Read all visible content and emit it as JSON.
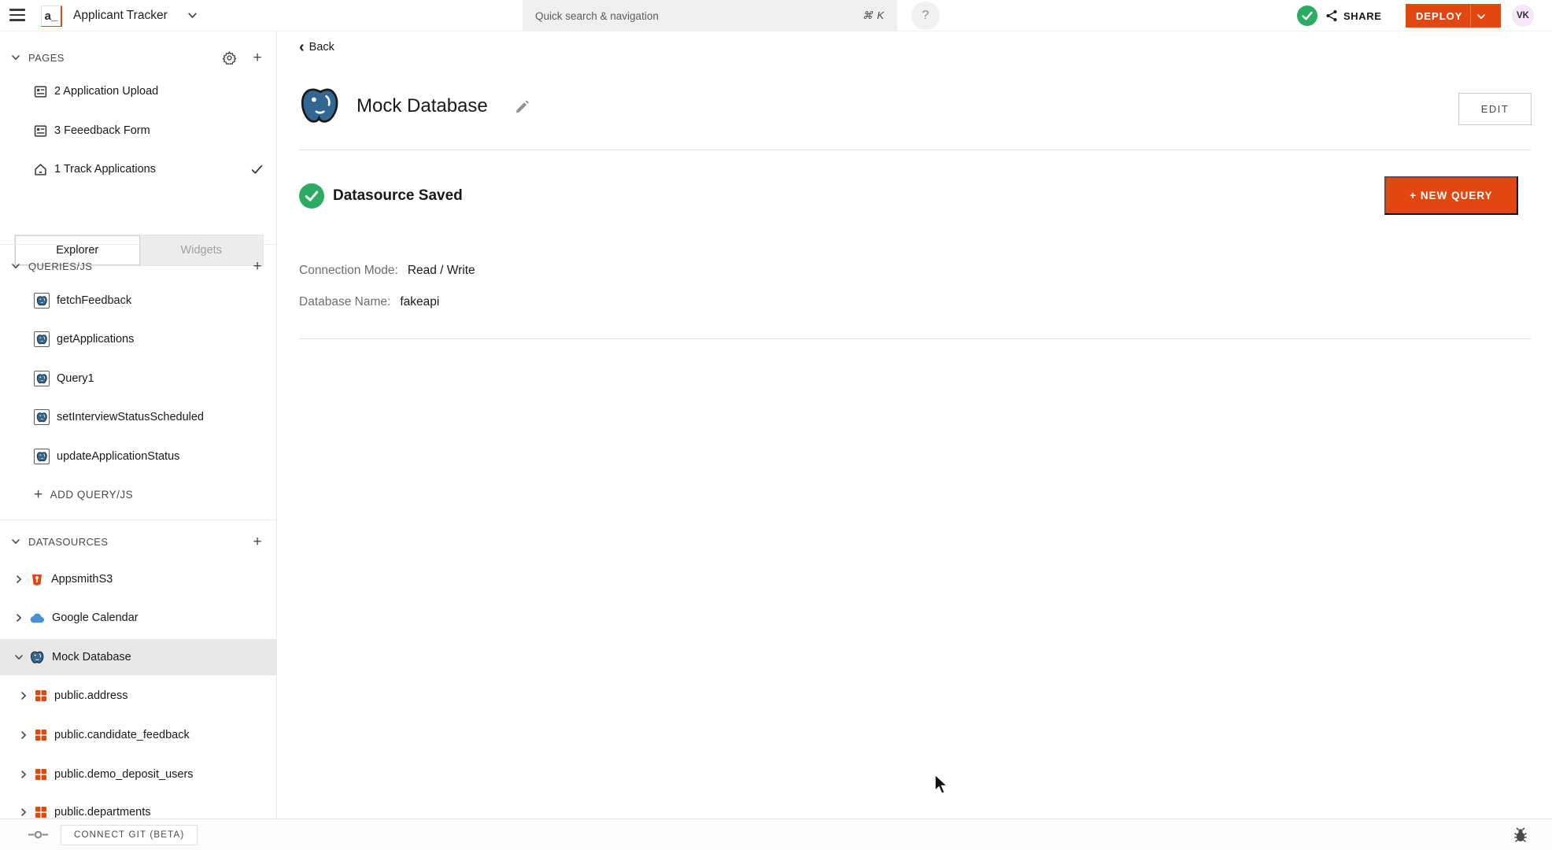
{
  "topbar": {
    "logo_text": "a_",
    "app_title": "Applicant Tracker",
    "search_placeholder": "Quick search & navigation",
    "search_shortcut": "⌘ K",
    "help_glyph": "?",
    "share_label": "SHARE",
    "deploy_label": "DEPLOY",
    "avatar_initials": "VK"
  },
  "icons": {
    "plus": "+",
    "back_chevron": "‹"
  },
  "sidebar": {
    "pages": {
      "title": "PAGES",
      "items": [
        {
          "label": "2 Application Upload"
        },
        {
          "label": "3 Feeedback Form"
        },
        {
          "label": "1 Track Applications"
        }
      ]
    },
    "tabs": {
      "explorer": "Explorer",
      "widgets": "Widgets"
    },
    "queries": {
      "title": "QUERIES/JS",
      "items": [
        "fetchFeedback",
        "getApplications",
        "Query1",
        "setInterviewStatusScheduled",
        "updateApplicationStatus"
      ],
      "add_label": "ADD QUERY/JS"
    },
    "datasources": {
      "title": "DATASOURCES",
      "items": [
        {
          "label": "AppsmithS3"
        },
        {
          "label": "Google Calendar"
        },
        {
          "label": "Mock Database"
        },
        {
          "label": "public.address"
        },
        {
          "label": "public.candidate_feedback"
        },
        {
          "label": "public.demo_deposit_users"
        },
        {
          "label": "public.departments"
        }
      ]
    }
  },
  "footer": {
    "connect_git_label": "CONNECT GIT (BETA)"
  },
  "main": {
    "back_label": "Back",
    "title": "Mock Database",
    "edit_button": "EDIT",
    "status_label": "Datasource Saved",
    "new_query_button": "+ NEW QUERY",
    "fields": [
      {
        "label": "Connection Mode:",
        "value": "Read / Write"
      },
      {
        "label": "Database Name:",
        "value": "fakeapi"
      }
    ]
  },
  "colors": {
    "accent_orange": "#E2470F",
    "success_green": "#2BAC62",
    "postgres_blue": "#336791"
  }
}
